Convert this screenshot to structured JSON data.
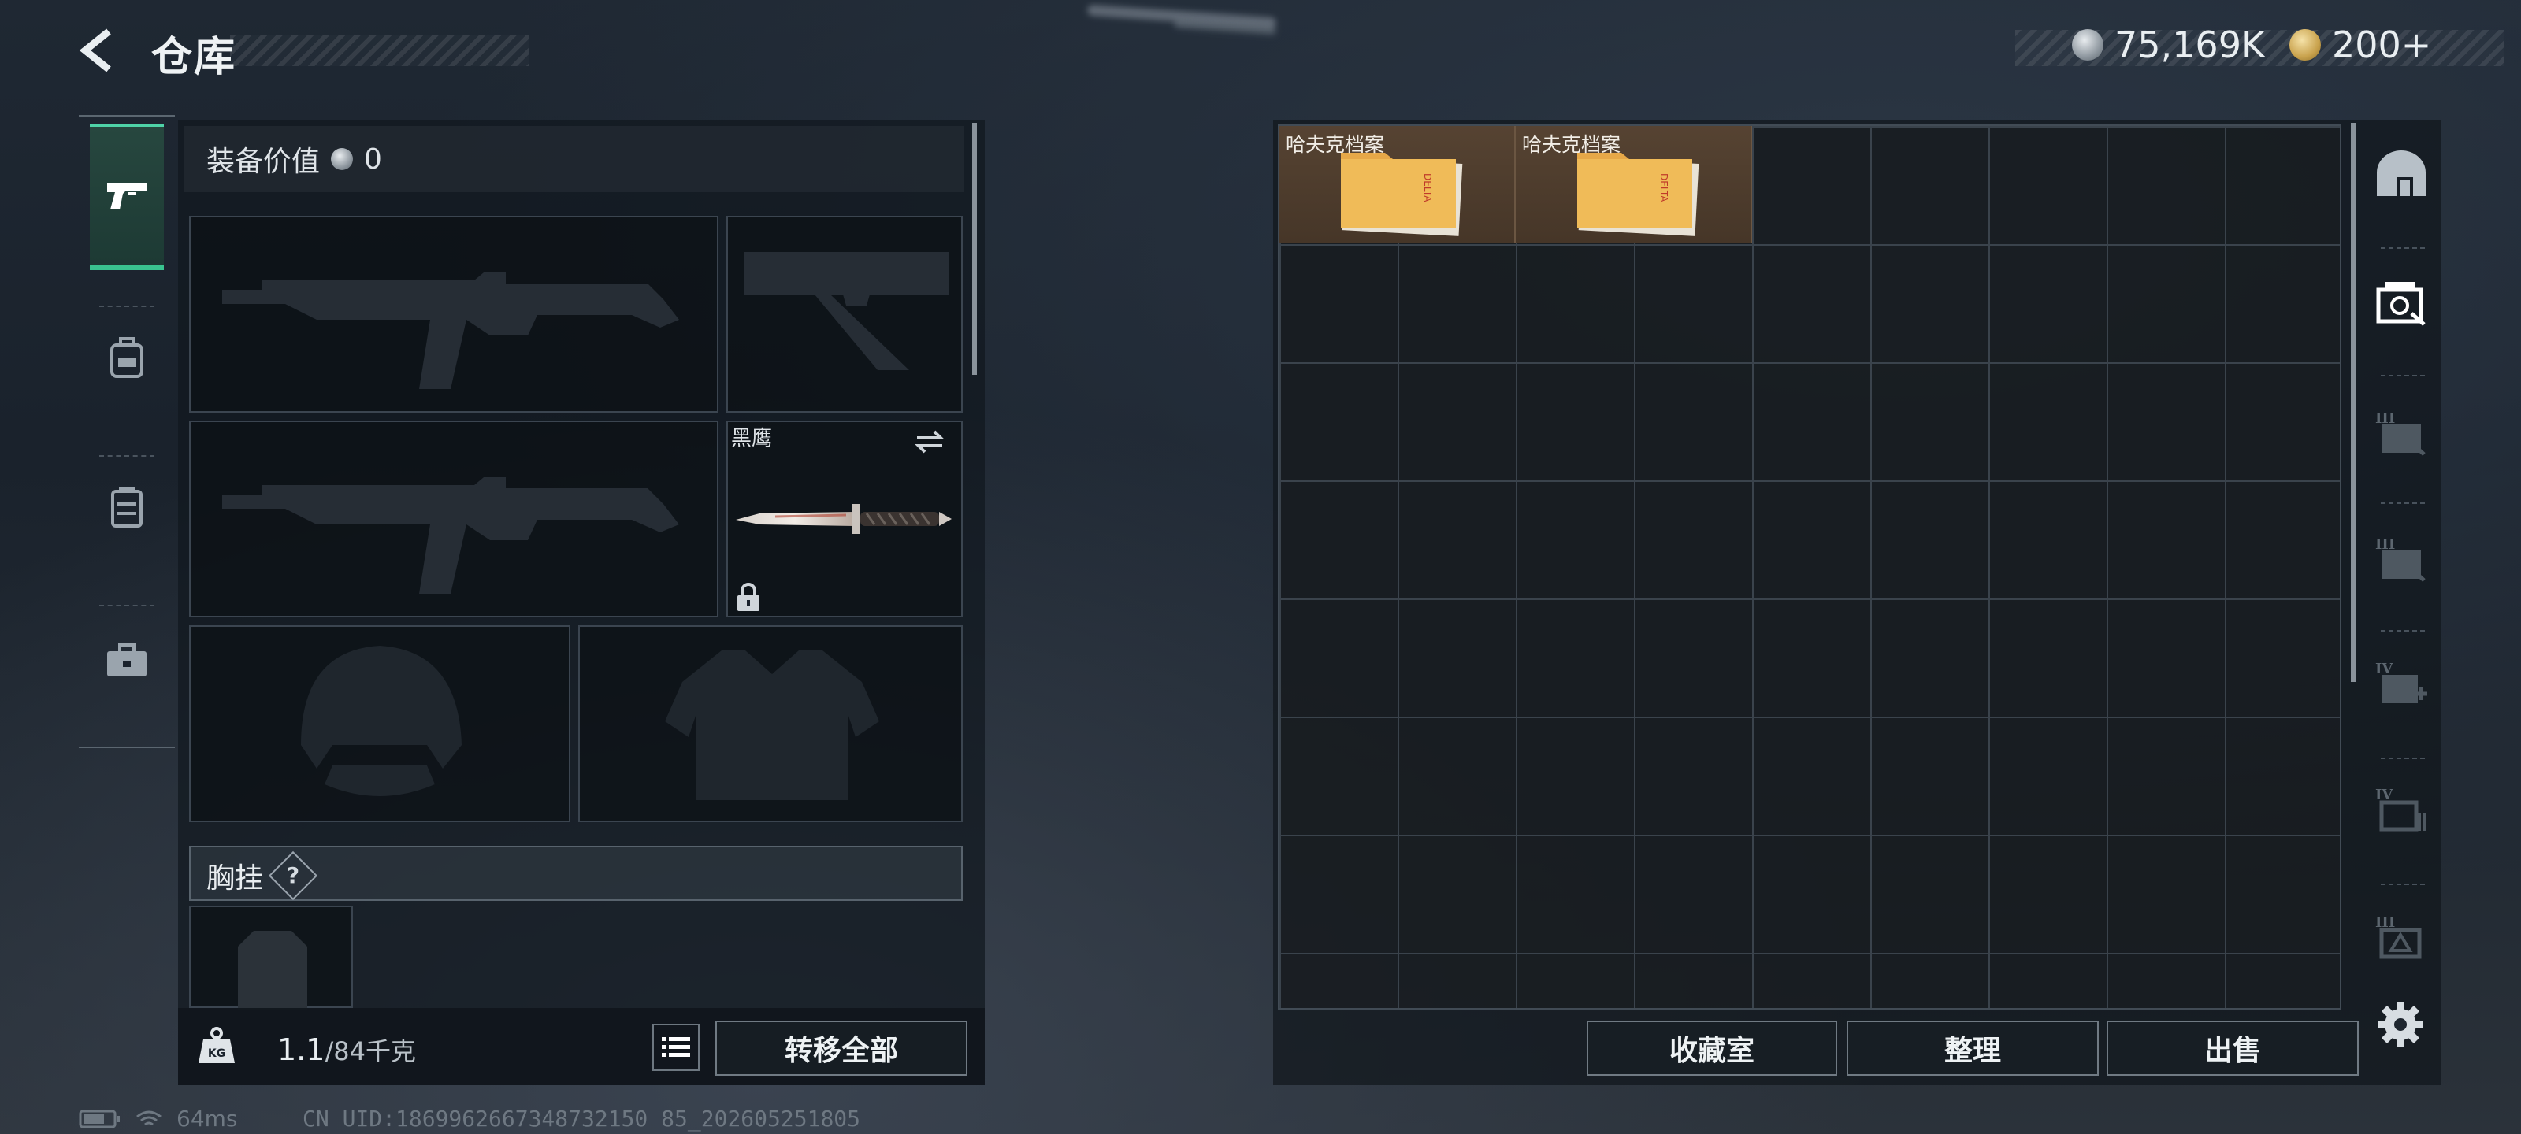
{
  "header": {
    "title": "仓库",
    "currency_silver": "75,169K",
    "currency_gold": "200+"
  },
  "left_nav": {
    "items": [
      {
        "icon": "pistol-icon",
        "active": true
      },
      {
        "icon": "backpack-icon",
        "active": false
      },
      {
        "icon": "chest-rig-icon",
        "active": false
      },
      {
        "icon": "case-icon",
        "active": false
      }
    ]
  },
  "equipment": {
    "value_label": "装备价值",
    "value": "0",
    "melee_name": "黑鹰",
    "chest_rig_label": "胸挂",
    "chest_rig_help": "?"
  },
  "footer_left": {
    "weight_current": "1.1",
    "weight_max": "/84千克",
    "transfer_all": "转移全部"
  },
  "storage": {
    "items": [
      {
        "name": "哈夫克档案",
        "col": 0,
        "row": 0
      },
      {
        "name": "哈夫克档案",
        "col": 2,
        "row": 0
      }
    ],
    "buttons": {
      "collection": "收藏室",
      "sort": "整理",
      "sell": "出售"
    }
  },
  "status": {
    "ping": "64ms",
    "uid": "CN UID:1869962667348732150 85_202605251805"
  }
}
